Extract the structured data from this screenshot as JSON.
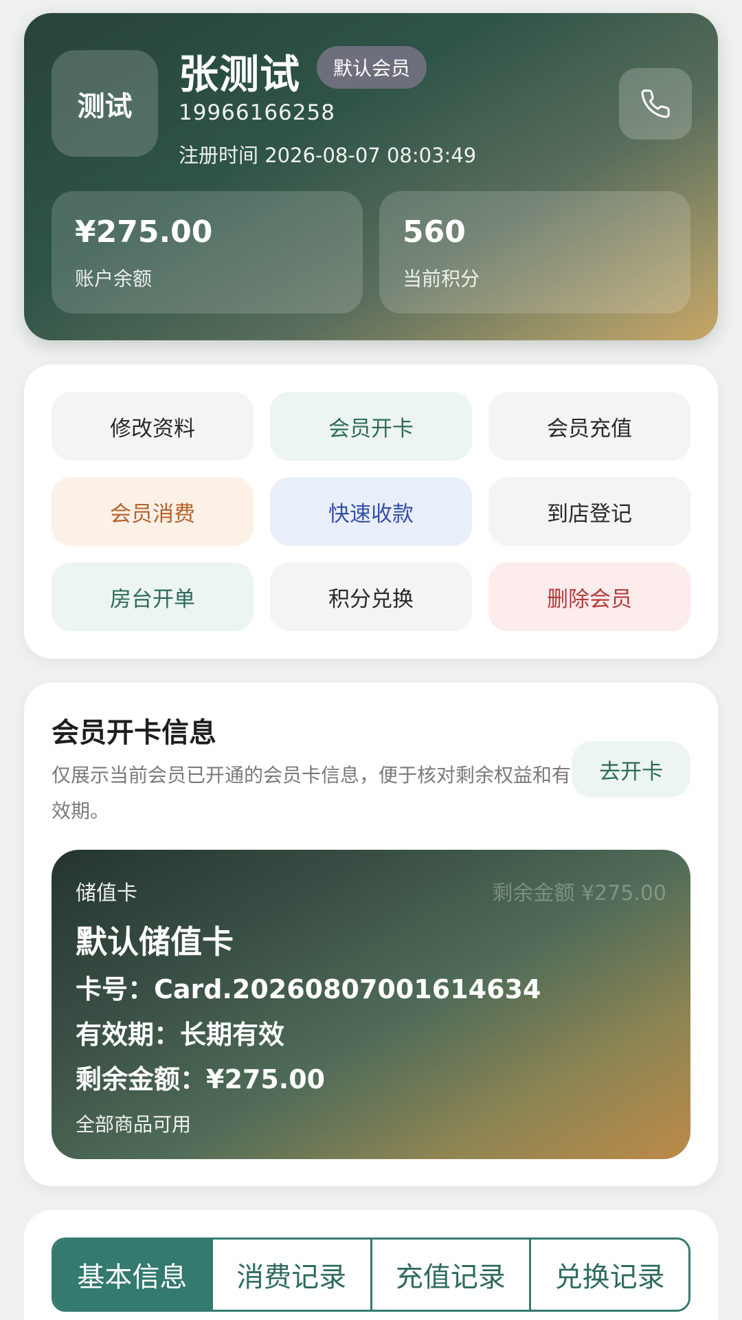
{
  "member": {
    "avatar_text": "测试",
    "name": "张测试",
    "level": "默认会员",
    "phone": "19966166258",
    "register_time": "注册时间 2026-08-07 08:03:49"
  },
  "stats": [
    {
      "value": "¥275.00",
      "label": "账户余额"
    },
    {
      "value": "560",
      "label": "当前积分"
    }
  ],
  "actions": [
    {
      "label": "修改资料",
      "tone": "neutral"
    },
    {
      "label": "会员开卡",
      "tone": "green"
    },
    {
      "label": "会员充值",
      "tone": "neutral"
    },
    {
      "label": "会员消费",
      "tone": "orange"
    },
    {
      "label": "快速收款",
      "tone": "blue"
    },
    {
      "label": "到店登记",
      "tone": "neutral"
    },
    {
      "label": "房台开单",
      "tone": "green"
    },
    {
      "label": "积分兑换",
      "tone": "neutral"
    },
    {
      "label": "删除会员",
      "tone": "red"
    }
  ],
  "card_section": {
    "title": "会员开卡信息",
    "description": "仅展示当前会员已开通的会员卡信息，便于核对剩余权益和有效期。",
    "go_button": "去开卡",
    "card": {
      "type": "储值卡",
      "remaining_top": "剩余金额 ¥275.00",
      "name": "默认储值卡",
      "number_line": "卡号：Card.20260807001614634",
      "validity_line": "有效期：长期有效",
      "balance_line": "剩余金额：¥275.00",
      "scope": "全部商品可用"
    }
  },
  "tabs": [
    {
      "label": "基本信息",
      "active": true
    },
    {
      "label": "消费记录",
      "active": false
    },
    {
      "label": "充值记录",
      "active": false
    },
    {
      "label": "兑换记录",
      "active": false
    }
  ],
  "colors": {
    "primary": "#347a6e",
    "hero_start": "#27433a",
    "hero_end": "#c9a464"
  }
}
